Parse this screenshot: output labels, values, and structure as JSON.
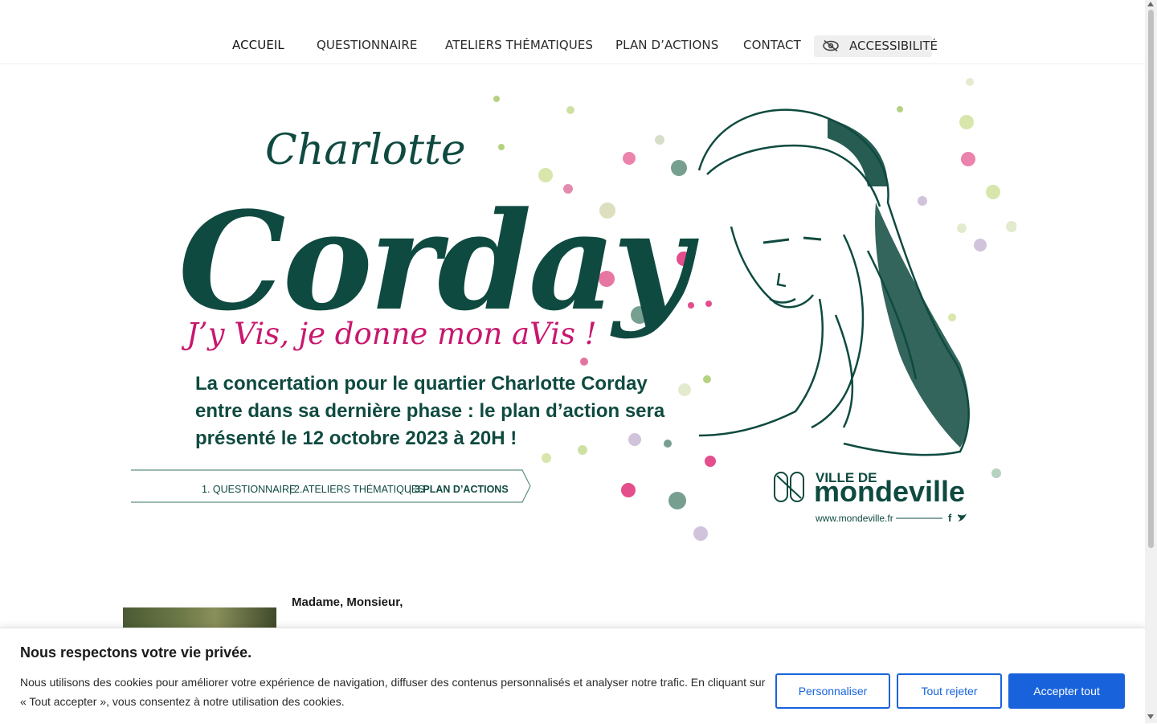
{
  "nav": {
    "items": [
      {
        "label": "ACCUEIL"
      },
      {
        "label": "QUESTIONNAIRE"
      },
      {
        "label": "ATELIERS THÉMATIQUES"
      },
      {
        "label": "PLAN D’ACTIONS"
      },
      {
        "label": "CONTACT"
      }
    ],
    "accessibility_label": "ACCESSIBILITÉ",
    "accessibility_icon": "eye-slash-icon"
  },
  "hero": {
    "script_title_1": "Charlotte",
    "script_title_2": "Corday",
    "tagline": "J’y Vis, je donne mon aVis !",
    "announcement_line1": "La concertation pour le quartier Charlotte Corday",
    "announcement_line2": "entre dans sa dernière phase :  le plan d’action sera",
    "announcement_line3": "présenté le 12 octobre 2023 à 20H !",
    "step1": "1. QUESTIONNAIRE",
    "step2": "2.ATELIERS THÉMATIQUES",
    "step3": "3.PLAN D’ACTIONS",
    "brand_small": "VILLE DE",
    "brand_big": "mondeville",
    "website": "www.mondeville.fr",
    "facebook_icon": "f",
    "twitter_icon": "twitter-bird",
    "colors": {
      "green": "#0f4a40",
      "magenta": "#c8186e"
    }
  },
  "content": {
    "greeting": "Madame, Monsieur,"
  },
  "cookie": {
    "title": "Nous respectons votre vie privée.",
    "text": "Nous utilisons des cookies pour améliorer votre expérience de navigation, diffuser des contenus personnalisés et analyser notre trafic. En cliquant sur « Tout accepter », vous consentez à notre utilisation des cookies.",
    "customize_label": "Personnaliser",
    "reject_label": "Tout rejeter",
    "accept_label": "Accepter tout",
    "accent": "#1863dc"
  }
}
